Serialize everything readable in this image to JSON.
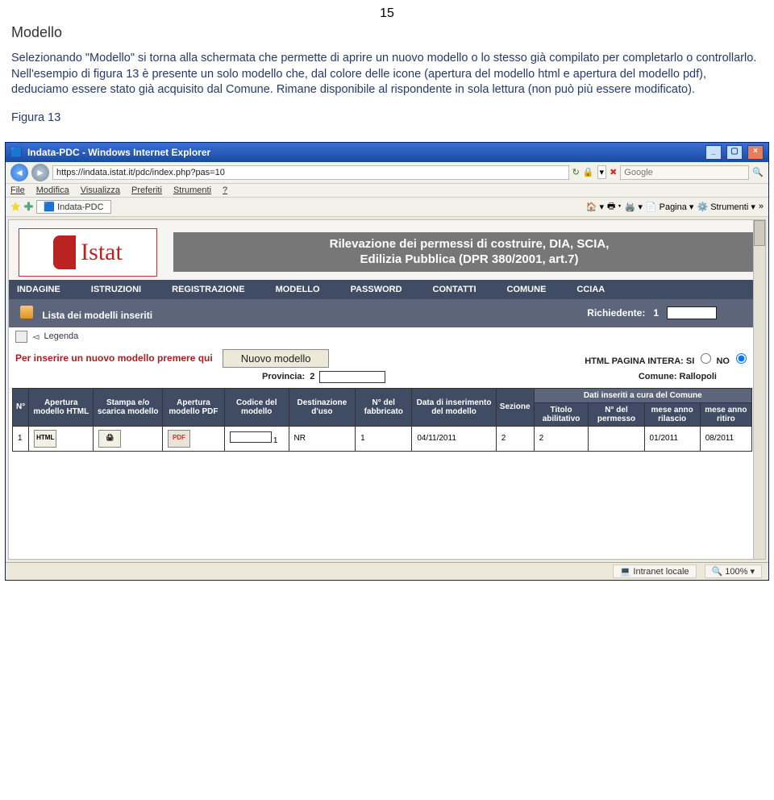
{
  "page_number": "15",
  "heading": "Modello",
  "body_text": "Selezionando \"Modello\" si torna alla schermata che permette di aprire un nuovo modello o lo stesso già compilato per completarlo o controllarlo. Nell'esempio di figura 13 è presente un solo modello che, dal colore delle icone (apertura del modello html e apertura del modello pdf), deduciamo essere stato già acquisito dal Comune. Rimane disponibile al rispondente in sola lettura (non può più essere modificato).",
  "figure_label": "Figura 13",
  "browser": {
    "title": "Indata-PDC - Windows Internet Explorer",
    "url": "https://indata.istat.it/pdc/index.php?pas=10",
    "menu": {
      "file": "File",
      "modifica": "Modifica",
      "visualizza": "Visualizza",
      "preferiti": "Preferiti",
      "strumenti": "Strumenti",
      "help": "?"
    },
    "tab": "Indata-PDC",
    "tools": {
      "pagina": "Pagina",
      "strumenti": "Strumenti"
    },
    "search_placeholder": "Google"
  },
  "site": {
    "logo_text": "Istat",
    "banner_line1": "Rilevazione dei permessi di costruire, DIA, SCIA,",
    "banner_line2": "Edilizia Pubblica (DPR 380/2001, art.7)",
    "nav": [
      "INDAGINE",
      "ISTRUZIONI",
      "REGISTRAZIONE",
      "MODELLO",
      "PASSWORD",
      "CONTATTI",
      "COMUNE",
      "CCIAA"
    ],
    "subhead_left": "Lista dei modelli inseriti",
    "subhead_right_label": "Richiedente:",
    "subhead_right_value": "1",
    "legend_label": "Legenda",
    "insert_label": "Per inserire un nuovo modello premere qui",
    "nuovo_btn": "Nuovo modello",
    "html_pagina_intera": "HTML PAGINA INTERA:",
    "si": "SI",
    "no": "NO",
    "provincia_label": "Provincia:",
    "provincia_value_prefix": "2",
    "comune_label": "Comune:",
    "comune_value": "Rallopoli",
    "group_header": "Dati inseriti a cura del Comune",
    "columns": {
      "c1": "N°",
      "c2": "Apertura modello HTML",
      "c3": "Stampa e/o scarica modello",
      "c4": "Apertura modello PDF",
      "c5": "Codice del modello",
      "c6": "Destinazione d'uso",
      "c7": "N° del fabbricato",
      "c8": "Data di inserimento del modello",
      "c9": "Sezione",
      "g1": "Titolo abilitativo",
      "g2": "N° del permesso",
      "g3": "mese anno rilascio",
      "g4": "mese anno ritiro"
    },
    "row": {
      "n": "1",
      "codice_suffix": "1",
      "dest": "NR",
      "fabb": "1",
      "data": "04/11/2011",
      "sezione": "2",
      "titolo": "2",
      "npermesso": "",
      "rilascio": "01/2011",
      "ritiro": "08/2011"
    }
  },
  "status": {
    "zone": "Intranet locale",
    "zoom": "100%"
  }
}
